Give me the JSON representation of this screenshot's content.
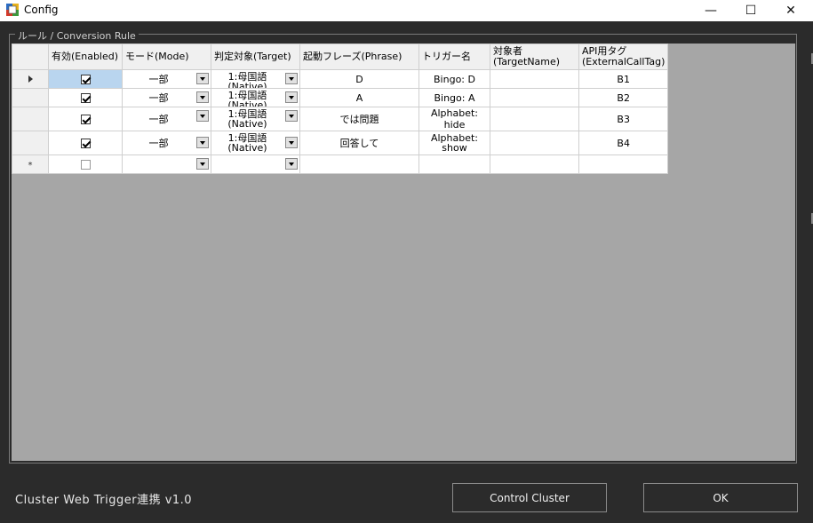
{
  "window": {
    "title": "Config",
    "minimize": "—",
    "maximize": "☐",
    "close": "✕"
  },
  "group": {
    "label": "ルール / Conversion Rule"
  },
  "grid": {
    "columns": [
      "有効(Enabled)",
      "モード(Mode)",
      "判定対象(Target)",
      "起動フレーズ(Phrase)",
      "トリガー名",
      "対象者\n(TargetName)",
      "API用タグ\n(ExternalCallTag)"
    ],
    "rows": [
      {
        "enabled": true,
        "mode": "一部",
        "target": "1:母国語\n(Native)",
        "phrase": "D",
        "trigger": "Bingo: D",
        "target_name": "",
        "tag": "B1"
      },
      {
        "enabled": true,
        "mode": "一部",
        "target": "1:母国語\n(Native)",
        "phrase": "A",
        "trigger": "Bingo: A",
        "target_name": "",
        "tag": "B2"
      },
      {
        "enabled": true,
        "mode": "一部",
        "target": "1:母国語\n(Native)",
        "phrase": "では問題",
        "trigger": "Alphabet: hide",
        "target_name": "",
        "tag": "B3"
      },
      {
        "enabled": true,
        "mode": "一部",
        "target": "1:母国語\n(Native)",
        "phrase": "回答して",
        "trigger": "Alphabet:\nshow",
        "target_name": "",
        "tag": "B4"
      }
    ],
    "new_row_marker": "*"
  },
  "footer": {
    "version_label": "Cluster Web Trigger連携 v1.0",
    "control_button": "Control Cluster",
    "ok_button": "OK"
  },
  "colors": {
    "background": "#2b2b2b",
    "grid_empty": "#a6a6a6",
    "selected_cell": "#b9d5ef"
  }
}
